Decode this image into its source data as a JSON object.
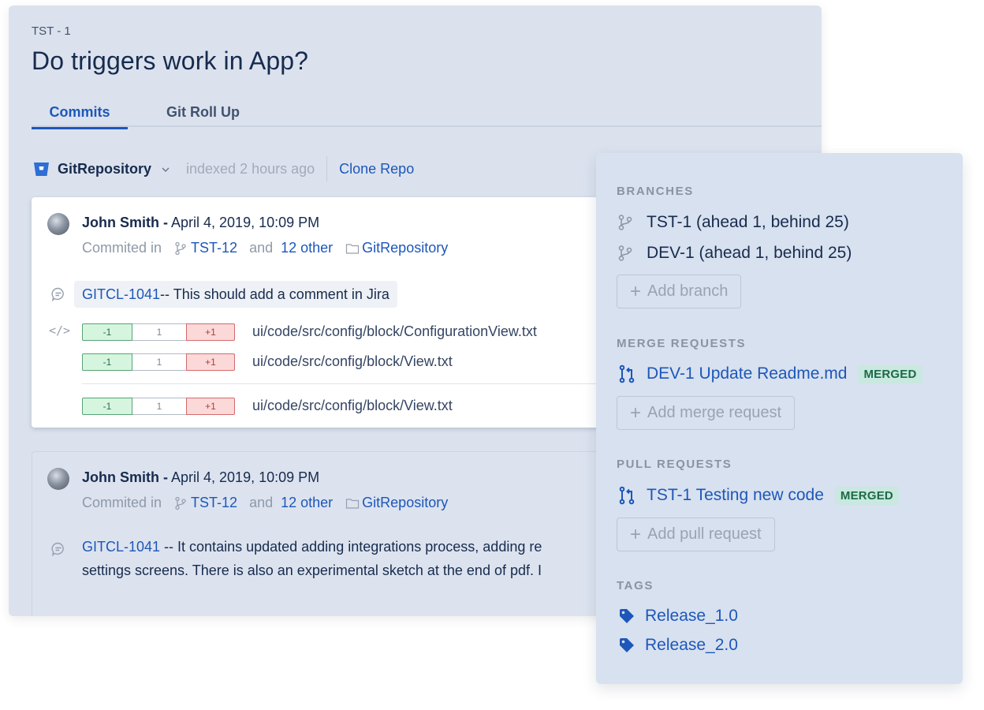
{
  "issue": {
    "key": "TST - 1",
    "title": "Do triggers work in App?"
  },
  "tabs": [
    {
      "label": "Commits",
      "active": true
    },
    {
      "label": "Git Roll Up",
      "active": false
    }
  ],
  "repo_bar": {
    "repo_name": "GitRepository",
    "indexed": "indexed 2 hours ago",
    "clone_label": "Clone Repo"
  },
  "commits": [
    {
      "author": "John Smith -",
      "date": "April 4, 2019, 10:09 PM",
      "committed_in_label": "Commited in",
      "branch": "TST-12",
      "and_label": "and",
      "others": "12 other",
      "repository": "GitRepository",
      "issue_key": "GITCL-1041",
      "message": " -- This should add a comment in Jira",
      "files": [
        {
          "removed": "-1",
          "unchanged": "1",
          "added": "+1",
          "path": "ui/code/src/config/block/ConfigurationView.txt"
        },
        {
          "removed": "-1",
          "unchanged": "1",
          "added": "+1",
          "path": "ui/code/src/config/block/View.txt"
        },
        {
          "removed": "-1",
          "unchanged": "1",
          "added": "+1",
          "path": "ui/code/src/config/block/View.txt"
        }
      ]
    },
    {
      "author": "John Smith -",
      "date": "April 4, 2019, 10:09 PM",
      "committed_in_label": "Commited in",
      "branch": "TST-12",
      "and_label": "and",
      "others": "12 other",
      "repository": "GitRepository",
      "issue_key": "GITCL-1041",
      "message_line1": " -- It contains updated adding integrations process, adding re",
      "message_line2": "settings screens. There is also an experimental sketch at the end of pdf. I"
    }
  ],
  "side_panel": {
    "branches": {
      "title": "BRANCHES",
      "items": [
        "TST-1 (ahead 1, behind 25)",
        "DEV-1 (ahead 1, behind 25)"
      ],
      "add_label": "Add branch"
    },
    "merge_requests": {
      "title": "MERGE REQUESTS",
      "items": [
        {
          "label": "DEV-1 Update Readme.md",
          "status": "MERGED"
        }
      ],
      "add_label": "Add merge request"
    },
    "pull_requests": {
      "title": "PULL REQUESTS",
      "items": [
        {
          "label": "TST-1 Testing new code",
          "status": "MERGED"
        }
      ],
      "add_label": "Add pull request"
    },
    "tags": {
      "title": "TAGS",
      "items": [
        "Release_1.0",
        "Release_2.0"
      ]
    },
    "add_plus": "+"
  },
  "colors": {
    "accent": "#1d57b9",
    "panel_bg": "#dbe2ee",
    "merged_badge_bg": "#c9e8df",
    "merged_badge_text": "#1b6b45",
    "diff_removed": "#d6f5df",
    "diff_added": "#fbd9d9"
  }
}
